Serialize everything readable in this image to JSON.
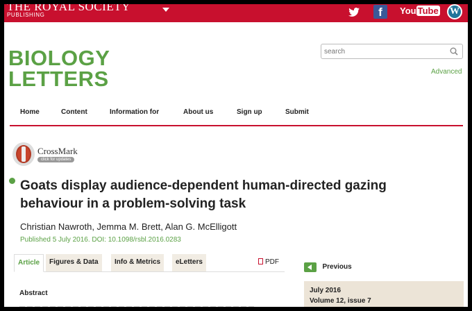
{
  "header": {
    "publisher_title": "THE ROYAL SOCIETY",
    "publisher_sub": "PUBLISHING",
    "social": {
      "facebook": "f",
      "youtube_you": "You",
      "youtube_tube": "Tube",
      "wordpress": "W"
    }
  },
  "logo": {
    "line1": "BIOLOGY",
    "line2": "LETTERS"
  },
  "search": {
    "placeholder": "search",
    "advanced_label": "Advanced"
  },
  "nav": {
    "items": [
      "Home",
      "Content",
      "Information for",
      "About us",
      "Sign up",
      "Submit"
    ]
  },
  "crossmark": {
    "label": "CrossMark",
    "pill": "click for updates"
  },
  "article": {
    "title": "Goats display audience-dependent human-directed gazing behaviour in a problem-solving task",
    "authors": "Christian Nawroth, Jemma M. Brett, Alan G. McElligott",
    "published": "Published 5 July 2016. DOI: 10.1098/rsbl.2016.0283"
  },
  "tabs": {
    "items": [
      "Article",
      "Figures & Data",
      "Info & Metrics",
      "eLetters"
    ],
    "active": 0,
    "pdf_label": "PDF"
  },
  "abstract": {
    "heading": "Abstract"
  },
  "sidebar": {
    "previous_label": "Previous",
    "issue_date": "July 2016",
    "issue_volume": "Volume 12, issue 7"
  },
  "colors": {
    "brand_red": "#c8102e",
    "brand_green": "#5ba145",
    "sidebar_bg": "#ece4d7"
  }
}
